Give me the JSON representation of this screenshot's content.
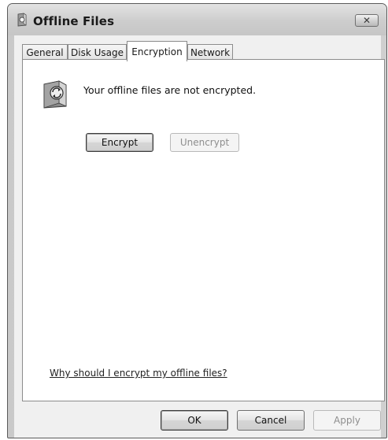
{
  "window": {
    "title": "Offline Files",
    "close_icon": "close-icon"
  },
  "tabs": [
    {
      "label": "General",
      "active": false
    },
    {
      "label": "Disk Usage",
      "active": false
    },
    {
      "label": "Encryption",
      "active": true
    },
    {
      "label": "Network",
      "active": false
    }
  ],
  "encryption": {
    "icon": "offline-files-sync-icon",
    "status": "Your offline files are not encrypted.",
    "encrypt_label": "Encrypt",
    "unencrypt_label": "Unencrypt",
    "help_link": "Why should I encrypt my offline files?"
  },
  "footer": {
    "ok_label": "OK",
    "cancel_label": "Cancel",
    "apply_label": "Apply"
  }
}
